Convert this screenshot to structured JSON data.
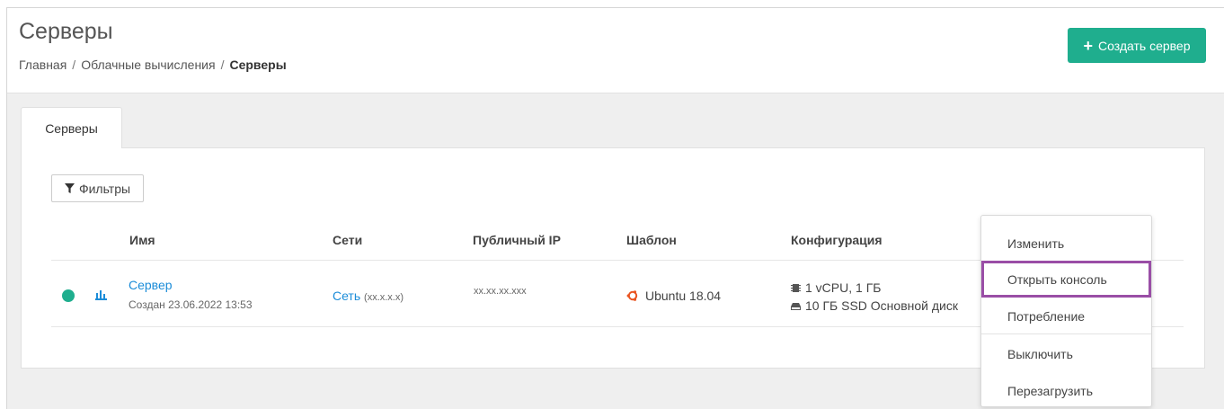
{
  "header": {
    "title": "Серверы",
    "breadcrumb": [
      "Главная",
      "Облачные вычисления",
      "Серверы"
    ],
    "create_button": "Создать сервер"
  },
  "tabs": [
    {
      "label": "Серверы",
      "active": true
    }
  ],
  "filters_button": "Фильтры",
  "table": {
    "columns": [
      "Имя",
      "Сети",
      "Публичный IP",
      "Шаблон",
      "Конфигурация"
    ],
    "rows": [
      {
        "status": "running",
        "name": "Сервер",
        "created": "Создан 23.06.2022 13:53",
        "network_name": "Сеть",
        "network_mask": "(xx.x.x.x)",
        "public_ip": "xx.xx.xx.xxx",
        "template": "Ubuntu 18.04",
        "config_cpu": "1 vCPU, 1 ГБ",
        "config_disk": "10 ГБ SSD Основной диск"
      }
    ]
  },
  "context_menu": {
    "items": [
      "Изменить",
      "Открыть консоль",
      "Потребление",
      "Выключить",
      "Перезагрузить"
    ],
    "highlighted": "Открыть консоль"
  },
  "colors": {
    "accent": "#1fae8e",
    "link": "#1b8cd8",
    "highlight_border": "#9a4ea6",
    "ubuntu": "#e95420"
  }
}
